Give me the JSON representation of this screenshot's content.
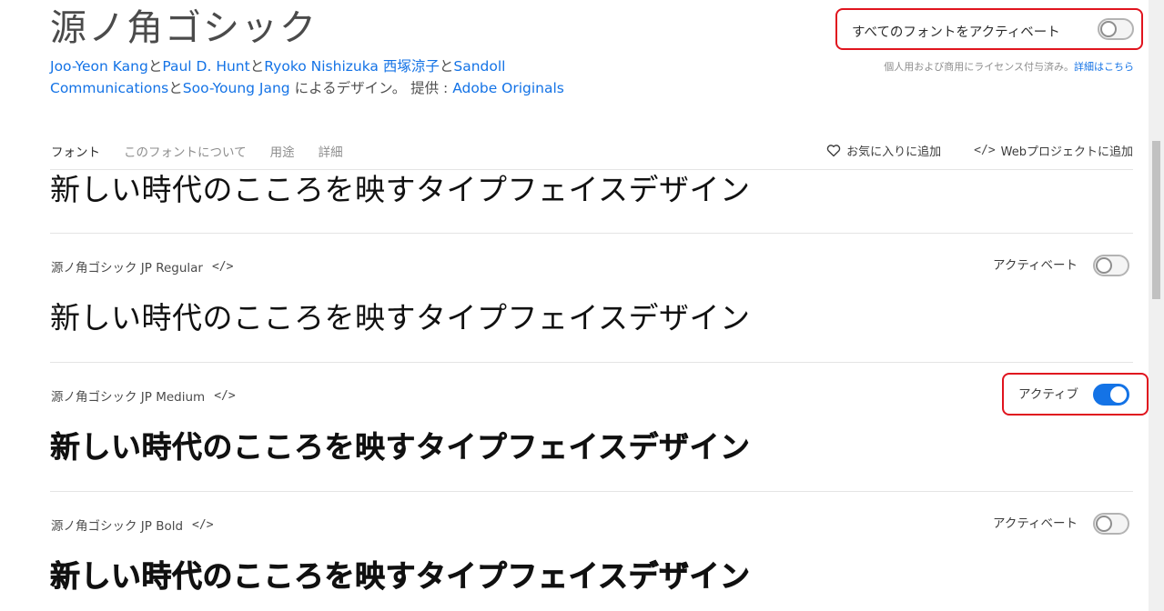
{
  "header": {
    "title": "源ノ角ゴシック",
    "credits": {
      "designer1": "Joo-Yeon Kang",
      "sep1": "と",
      "designer2": "Paul D. Hunt",
      "sep2": "と",
      "designer3": "Ryoko Nishizuka 西塚涼子",
      "sep3": "と",
      "designer4": "Sandoll Communications",
      "sep4": "と",
      "designer5": "Soo-Young Jang",
      "by_text": " によるデザイン。 提供 : ",
      "foundry": "Adobe Originals"
    },
    "activate_all_label": "すべてのフォントをアクティベート",
    "activate_all_on": false,
    "license_text": "個人用および商用にライセンス付与済み。",
    "license_link": "詳細はこちら"
  },
  "tabs": [
    {
      "label": "フォント",
      "active": true
    },
    {
      "label": "このフォントについて",
      "active": false
    },
    {
      "label": "用途",
      "active": false
    },
    {
      "label": "詳細",
      "active": false
    }
  ],
  "actions": {
    "favorite_label": "お気に入りに追加",
    "web_project_label": "Webプロジェクトに追加",
    "favorite_icon": "heart-icon",
    "web_icon": "code-icon"
  },
  "sample_text": "新しい時代のこころを映すタイプフェイスデザイン",
  "fonts": [
    {
      "name": "源ノ角ゴシック JP Regular",
      "toggle_label": "アクティベート",
      "active": false,
      "weight": "regular"
    },
    {
      "name": "源ノ角ゴシック JP Medium",
      "toggle_label": "アクティブ",
      "active": true,
      "weight": "medium"
    },
    {
      "name": "源ノ角ゴシック JP Bold",
      "toggle_label": "アクティベート",
      "active": false,
      "weight": "bold"
    }
  ],
  "code_glyph": "</>",
  "colors": {
    "accent": "#1473e6",
    "highlight": "#e0141e"
  }
}
